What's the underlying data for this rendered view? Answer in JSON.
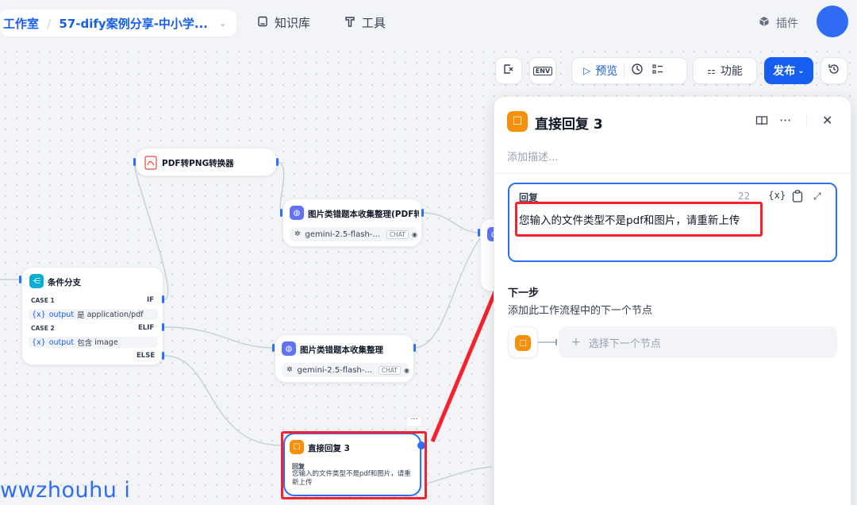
{
  "header": {
    "studio": "工作室",
    "app_name": "57-dify案例分享-中小学...",
    "nav": [
      {
        "label": "知识库",
        "icon": "book-icon"
      },
      {
        "label": "工具",
        "icon": "tool-icon"
      }
    ],
    "plugin": "插件"
  },
  "toolbar": {
    "env": "ENV",
    "preview": "预览",
    "features": "功能",
    "publish": "发布"
  },
  "nodes": {
    "pdf2png": {
      "title": "PDF转PNG转换器"
    },
    "llm1": {
      "title": "图片类错题本收集整理(PDF转",
      "model": "gemini-2.5-flash-...",
      "tag": "CHAT"
    },
    "llm2": {
      "title": "图片类错题本收集整理",
      "model": "gemini-2.5-flash-...",
      "tag": "CHAT"
    },
    "ifelse": {
      "title": "条件分支",
      "case1": "CASE 1",
      "if": "IF",
      "cond1_var": "output",
      "cond1_op": "是",
      "cond1_val": "application/pdf",
      "case2": "CASE 2",
      "elif": "ELIF",
      "cond2_var": "output",
      "cond2_op": "包含",
      "cond2_val": "image",
      "else": "ELSE"
    },
    "reply3": {
      "title": "直接回复 3",
      "label": "回复",
      "text": "您输入的文件类型不是pdf和图片，请重新上传"
    }
  },
  "panel": {
    "title": "直接回复 3",
    "description_placeholder": "添加描述...",
    "reply_label": "回复",
    "char_count": "22",
    "reply_text": "您输入的文件类型不是pdf和图片，请重新上传",
    "var_button": "{x}",
    "next_title": "下一步",
    "next_desc": "添加此工作流程中的下一个节点",
    "select_next": "选择下一个节点"
  },
  "watermark": "wwzhouhu i",
  "colors": {
    "accent": "#155eef",
    "reply_node": "#f79009",
    "llm_node": "#6172f3",
    "highlight": "#f5222d"
  }
}
